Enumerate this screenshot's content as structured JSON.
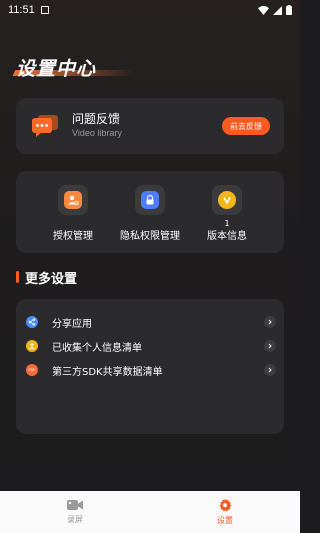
{
  "status_bar": {
    "time": "11:51"
  },
  "header": {
    "title": "设置中心"
  },
  "feedback": {
    "title": "问题反馈",
    "subtitle": "Video library",
    "button_label": "前去反馈"
  },
  "permissions": {
    "items": [
      {
        "label": "授权管理",
        "icon": "user-auth-icon",
        "color": "#ff8a3d"
      },
      {
        "label": "隐私权限管理",
        "icon": "lock-icon",
        "color": "#4d7cff"
      },
      {
        "label": "版本信息",
        "icon": "version-icon",
        "color": "#f2b51c",
        "badge": "1"
      }
    ]
  },
  "more_settings": {
    "title": "更多设置",
    "items": [
      {
        "label": "分享应用",
        "icon": "share-icon",
        "color": "#4a8dff"
      },
      {
        "label": "已收集个人信息清单",
        "icon": "person-info-icon",
        "color": "#f2b51c"
      },
      {
        "label": "第三方SDK共享数据清单",
        "icon": "sdk-icon",
        "color": "#ff6a3d",
        "icon_text": "SDK"
      }
    ]
  },
  "bottom_nav": {
    "tabs": [
      {
        "label": "录屏",
        "icon": "video-camera-icon",
        "active": false
      },
      {
        "label": "设置",
        "icon": "settings-icon",
        "active": true
      }
    ],
    "active_color": "#ff5a1f",
    "inactive_color": "#9a9a9c"
  }
}
